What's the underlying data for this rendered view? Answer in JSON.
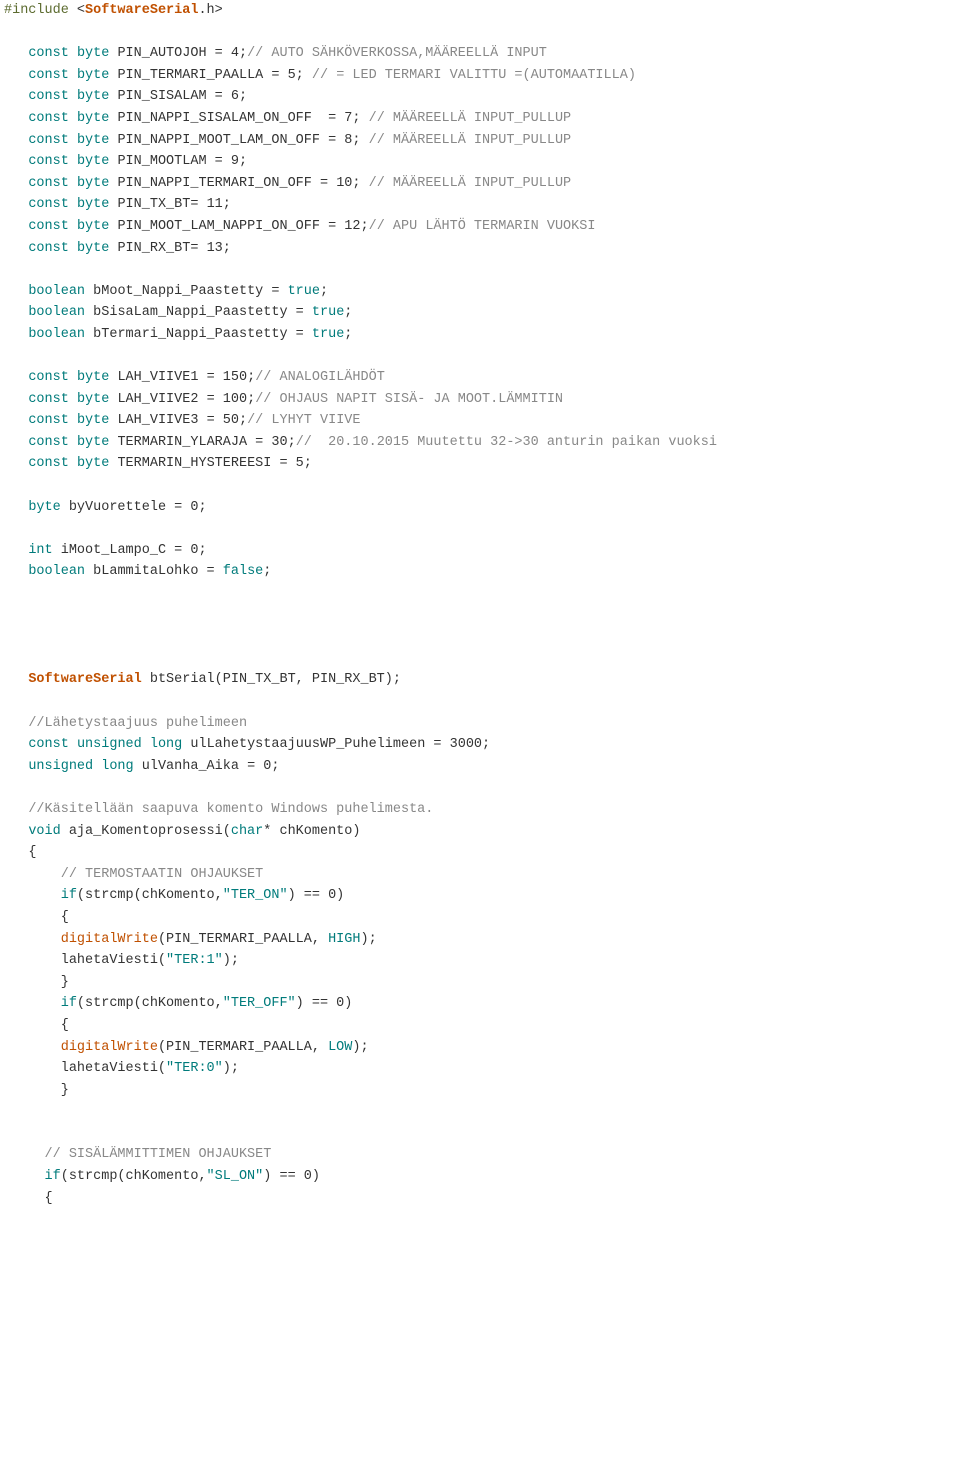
{
  "lines": [
    {
      "t": "include",
      "header": "SoftwareSerial"
    },
    {
      "t": "blank"
    },
    {
      "t": "raw",
      "segs": [
        {
          "c": "sp",
          "v": "   "
        },
        {
          "c": "kw",
          "v": "const"
        },
        {
          "c": "sp",
          "v": " "
        },
        {
          "c": "kw",
          "v": "byte"
        },
        {
          "c": "sp",
          "v": " "
        },
        {
          "c": "plain",
          "v": "PIN_AUTOJOH = 4;"
        },
        {
          "c": "cmt",
          "v": "// AUTO SÄHKÖVERKOSSA,MÄÄREELLÄ INPUT"
        }
      ]
    },
    {
      "t": "raw",
      "segs": [
        {
          "c": "sp",
          "v": "   "
        },
        {
          "c": "kw",
          "v": "const"
        },
        {
          "c": "sp",
          "v": " "
        },
        {
          "c": "kw",
          "v": "byte"
        },
        {
          "c": "sp",
          "v": " "
        },
        {
          "c": "plain",
          "v": "PIN_TERMARI_PAALLA = 5; "
        },
        {
          "c": "cmt",
          "v": "// = LED TERMARI VALITTU =(AUTOMAATILLA)"
        }
      ]
    },
    {
      "t": "raw",
      "segs": [
        {
          "c": "sp",
          "v": "   "
        },
        {
          "c": "kw",
          "v": "const"
        },
        {
          "c": "sp",
          "v": " "
        },
        {
          "c": "kw",
          "v": "byte"
        },
        {
          "c": "sp",
          "v": " "
        },
        {
          "c": "plain",
          "v": "PIN_SISALAM = 6;"
        }
      ]
    },
    {
      "t": "raw",
      "segs": [
        {
          "c": "sp",
          "v": "   "
        },
        {
          "c": "kw",
          "v": "const"
        },
        {
          "c": "sp",
          "v": " "
        },
        {
          "c": "kw",
          "v": "byte"
        },
        {
          "c": "sp",
          "v": " "
        },
        {
          "c": "plain",
          "v": "PIN_NAPPI_SISALAM_ON_OFF  = 7; "
        },
        {
          "c": "cmt",
          "v": "// MÄÄREELLÄ INPUT_PULLUP"
        }
      ]
    },
    {
      "t": "raw",
      "segs": [
        {
          "c": "sp",
          "v": "   "
        },
        {
          "c": "kw",
          "v": "const"
        },
        {
          "c": "sp",
          "v": " "
        },
        {
          "c": "kw",
          "v": "byte"
        },
        {
          "c": "sp",
          "v": " "
        },
        {
          "c": "plain",
          "v": "PIN_NAPPI_MOOT_LAM_ON_OFF = 8; "
        },
        {
          "c": "cmt",
          "v": "// MÄÄREELLÄ INPUT_PULLUP"
        }
      ]
    },
    {
      "t": "raw",
      "segs": [
        {
          "c": "sp",
          "v": "   "
        },
        {
          "c": "kw",
          "v": "const"
        },
        {
          "c": "sp",
          "v": " "
        },
        {
          "c": "kw",
          "v": "byte"
        },
        {
          "c": "sp",
          "v": " "
        },
        {
          "c": "plain",
          "v": "PIN_MOOTLAM = 9;"
        }
      ]
    },
    {
      "t": "raw",
      "segs": [
        {
          "c": "sp",
          "v": "   "
        },
        {
          "c": "kw",
          "v": "const"
        },
        {
          "c": "sp",
          "v": " "
        },
        {
          "c": "kw",
          "v": "byte"
        },
        {
          "c": "sp",
          "v": " "
        },
        {
          "c": "plain",
          "v": "PIN_NAPPI_TERMARI_ON_OFF = 10; "
        },
        {
          "c": "cmt",
          "v": "// MÄÄREELLÄ INPUT_PULLUP"
        }
      ]
    },
    {
      "t": "raw",
      "segs": [
        {
          "c": "sp",
          "v": "   "
        },
        {
          "c": "kw",
          "v": "const"
        },
        {
          "c": "sp",
          "v": " "
        },
        {
          "c": "kw",
          "v": "byte"
        },
        {
          "c": "sp",
          "v": " "
        },
        {
          "c": "plain",
          "v": "PIN_TX_BT= 11;"
        }
      ]
    },
    {
      "t": "raw",
      "segs": [
        {
          "c": "sp",
          "v": "   "
        },
        {
          "c": "kw",
          "v": "const"
        },
        {
          "c": "sp",
          "v": " "
        },
        {
          "c": "kw",
          "v": "byte"
        },
        {
          "c": "sp",
          "v": " "
        },
        {
          "c": "plain",
          "v": "PIN_MOOT_LAM_NAPPI_ON_OFF = 12;"
        },
        {
          "c": "cmt",
          "v": "// APU LÄHTÖ TERMARIN VUOKSI"
        }
      ]
    },
    {
      "t": "raw",
      "segs": [
        {
          "c": "sp",
          "v": "   "
        },
        {
          "c": "kw",
          "v": "const"
        },
        {
          "c": "sp",
          "v": " "
        },
        {
          "c": "kw",
          "v": "byte"
        },
        {
          "c": "sp",
          "v": " "
        },
        {
          "c": "plain",
          "v": "PIN_RX_BT= 13;"
        }
      ]
    },
    {
      "t": "blank"
    },
    {
      "t": "raw",
      "segs": [
        {
          "c": "sp",
          "v": "   "
        },
        {
          "c": "kw",
          "v": "boolean"
        },
        {
          "c": "sp",
          "v": " "
        },
        {
          "c": "plain",
          "v": "bMoot_Nappi_Paastetty = "
        },
        {
          "c": "lit",
          "v": "true"
        },
        {
          "c": "plain",
          "v": ";"
        }
      ]
    },
    {
      "t": "raw",
      "segs": [
        {
          "c": "sp",
          "v": "   "
        },
        {
          "c": "kw",
          "v": "boolean"
        },
        {
          "c": "sp",
          "v": " "
        },
        {
          "c": "plain",
          "v": "bSisaLam_Nappi_Paastetty = "
        },
        {
          "c": "lit",
          "v": "true"
        },
        {
          "c": "plain",
          "v": ";"
        }
      ]
    },
    {
      "t": "raw",
      "segs": [
        {
          "c": "sp",
          "v": "   "
        },
        {
          "c": "kw",
          "v": "boolean"
        },
        {
          "c": "sp",
          "v": " "
        },
        {
          "c": "plain",
          "v": "bTermari_Nappi_Paastetty = "
        },
        {
          "c": "lit",
          "v": "true"
        },
        {
          "c": "plain",
          "v": ";"
        }
      ]
    },
    {
      "t": "blank"
    },
    {
      "t": "raw",
      "segs": [
        {
          "c": "sp",
          "v": "   "
        },
        {
          "c": "kw",
          "v": "const"
        },
        {
          "c": "sp",
          "v": " "
        },
        {
          "c": "kw",
          "v": "byte"
        },
        {
          "c": "sp",
          "v": " "
        },
        {
          "c": "plain",
          "v": "LAH_VIIVE1 = 150;"
        },
        {
          "c": "cmt",
          "v": "// ANALOGILÄHDÖT"
        }
      ]
    },
    {
      "t": "raw",
      "segs": [
        {
          "c": "sp",
          "v": "   "
        },
        {
          "c": "kw",
          "v": "const"
        },
        {
          "c": "sp",
          "v": " "
        },
        {
          "c": "kw",
          "v": "byte"
        },
        {
          "c": "sp",
          "v": " "
        },
        {
          "c": "plain",
          "v": "LAH_VIIVE2 = 100;"
        },
        {
          "c": "cmt",
          "v": "// OHJAUS NAPIT SISÄ- JA MOOT.LÄMMITIN"
        }
      ]
    },
    {
      "t": "raw",
      "segs": [
        {
          "c": "sp",
          "v": "   "
        },
        {
          "c": "kw",
          "v": "const"
        },
        {
          "c": "sp",
          "v": " "
        },
        {
          "c": "kw",
          "v": "byte"
        },
        {
          "c": "sp",
          "v": " "
        },
        {
          "c": "plain",
          "v": "LAH_VIIVE3 = 50;"
        },
        {
          "c": "cmt",
          "v": "// LYHYT VIIVE"
        }
      ]
    },
    {
      "t": "raw",
      "segs": [
        {
          "c": "sp",
          "v": "   "
        },
        {
          "c": "kw",
          "v": "const"
        },
        {
          "c": "sp",
          "v": " "
        },
        {
          "c": "kw",
          "v": "byte"
        },
        {
          "c": "sp",
          "v": " "
        },
        {
          "c": "plain",
          "v": "TERMARIN_YLARAJA = 30;"
        },
        {
          "c": "cmt",
          "v": "//  20.10.2015 Muutettu 32->30 anturin paikan vuoksi"
        }
      ]
    },
    {
      "t": "raw",
      "segs": [
        {
          "c": "sp",
          "v": "   "
        },
        {
          "c": "kw",
          "v": "const"
        },
        {
          "c": "sp",
          "v": " "
        },
        {
          "c": "kw",
          "v": "byte"
        },
        {
          "c": "sp",
          "v": " "
        },
        {
          "c": "plain",
          "v": "TERMARIN_HYSTEREESI = 5;"
        }
      ]
    },
    {
      "t": "blank"
    },
    {
      "t": "raw",
      "segs": [
        {
          "c": "sp",
          "v": "   "
        },
        {
          "c": "kw",
          "v": "byte"
        },
        {
          "c": "sp",
          "v": " "
        },
        {
          "c": "plain",
          "v": "byVuorettele = 0;"
        }
      ]
    },
    {
      "t": "blank"
    },
    {
      "t": "raw",
      "segs": [
        {
          "c": "sp",
          "v": "   "
        },
        {
          "c": "kw",
          "v": "int"
        },
        {
          "c": "sp",
          "v": " "
        },
        {
          "c": "plain",
          "v": "iMoot_Lampo_C = 0;"
        }
      ]
    },
    {
      "t": "raw",
      "segs": [
        {
          "c": "sp",
          "v": "   "
        },
        {
          "c": "kw",
          "v": "boolean"
        },
        {
          "c": "sp",
          "v": " "
        },
        {
          "c": "plain",
          "v": "bLammitaLohko = "
        },
        {
          "c": "lit",
          "v": "false"
        },
        {
          "c": "plain",
          "v": ";"
        }
      ]
    },
    {
      "t": "blank"
    },
    {
      "t": "blank"
    },
    {
      "t": "blank"
    },
    {
      "t": "blank"
    },
    {
      "t": "raw",
      "segs": [
        {
          "c": "sp",
          "v": "   "
        },
        {
          "c": "type",
          "v": "SoftwareSerial"
        },
        {
          "c": "sp",
          "v": " "
        },
        {
          "c": "plain",
          "v": "btSerial(PIN_TX_BT, PIN_RX_BT);"
        }
      ]
    },
    {
      "t": "blank"
    },
    {
      "t": "raw",
      "segs": [
        {
          "c": "sp",
          "v": "   "
        },
        {
          "c": "cmt",
          "v": "//Lähetystaajuus puhelimeen"
        }
      ]
    },
    {
      "t": "raw",
      "segs": [
        {
          "c": "sp",
          "v": "   "
        },
        {
          "c": "kw",
          "v": "const"
        },
        {
          "c": "sp",
          "v": " "
        },
        {
          "c": "kw",
          "v": "unsigned"
        },
        {
          "c": "sp",
          "v": " "
        },
        {
          "c": "kw",
          "v": "long"
        },
        {
          "c": "sp",
          "v": " "
        },
        {
          "c": "plain",
          "v": "ulLahetystaajuusWP_Puhelimeen = 3000;"
        }
      ]
    },
    {
      "t": "raw",
      "segs": [
        {
          "c": "sp",
          "v": "   "
        },
        {
          "c": "kw",
          "v": "unsigned"
        },
        {
          "c": "sp",
          "v": " "
        },
        {
          "c": "kw",
          "v": "long"
        },
        {
          "c": "sp",
          "v": " "
        },
        {
          "c": "plain",
          "v": "ulVanha_Aika = 0;"
        }
      ]
    },
    {
      "t": "blank"
    },
    {
      "t": "raw",
      "segs": [
        {
          "c": "sp",
          "v": "   "
        },
        {
          "c": "cmt",
          "v": "//Käsitellään saapuva komento Windows puhelimesta."
        }
      ]
    },
    {
      "t": "raw",
      "segs": [
        {
          "c": "sp",
          "v": "   "
        },
        {
          "c": "kw",
          "v": "void"
        },
        {
          "c": "sp",
          "v": " "
        },
        {
          "c": "plain",
          "v": "aja_Komentoprosessi("
        },
        {
          "c": "kw",
          "v": "char"
        },
        {
          "c": "plain",
          "v": "* chKomento)"
        }
      ]
    },
    {
      "t": "raw",
      "segs": [
        {
          "c": "sp",
          "v": "   "
        },
        {
          "c": "plain",
          "v": "{"
        }
      ]
    },
    {
      "t": "raw",
      "segs": [
        {
          "c": "sp",
          "v": "       "
        },
        {
          "c": "cmt",
          "v": "// TERMOSTAATIN OHJAUKSET"
        }
      ]
    },
    {
      "t": "raw",
      "segs": [
        {
          "c": "sp",
          "v": "       "
        },
        {
          "c": "kw",
          "v": "if"
        },
        {
          "c": "plain",
          "v": "(strcmp(chKomento,"
        },
        {
          "c": "str",
          "v": "\"TER_ON\""
        },
        {
          "c": "plain",
          "v": ") == 0)"
        }
      ]
    },
    {
      "t": "raw",
      "segs": [
        {
          "c": "sp",
          "v": "       "
        },
        {
          "c": "plain",
          "v": "{"
        }
      ]
    },
    {
      "t": "raw",
      "segs": [
        {
          "c": "sp",
          "v": "       "
        },
        {
          "c": "fn",
          "v": "digitalWrite"
        },
        {
          "c": "plain",
          "v": "(PIN_TERMARI_PAALLA, "
        },
        {
          "c": "lit",
          "v": "HIGH"
        },
        {
          "c": "plain",
          "v": ");"
        }
      ]
    },
    {
      "t": "raw",
      "segs": [
        {
          "c": "sp",
          "v": "       "
        },
        {
          "c": "plain",
          "v": "lahetaViesti("
        },
        {
          "c": "str",
          "v": "\"TER:1\""
        },
        {
          "c": "plain",
          "v": ");"
        }
      ]
    },
    {
      "t": "raw",
      "segs": [
        {
          "c": "sp",
          "v": "       "
        },
        {
          "c": "plain",
          "v": "}"
        }
      ]
    },
    {
      "t": "raw",
      "segs": [
        {
          "c": "sp",
          "v": "       "
        },
        {
          "c": "kw",
          "v": "if"
        },
        {
          "c": "plain",
          "v": "(strcmp(chKomento,"
        },
        {
          "c": "str",
          "v": "\"TER_OFF\""
        },
        {
          "c": "plain",
          "v": ") == 0)"
        }
      ]
    },
    {
      "t": "raw",
      "segs": [
        {
          "c": "sp",
          "v": "       "
        },
        {
          "c": "plain",
          "v": "{"
        }
      ]
    },
    {
      "t": "raw",
      "segs": [
        {
          "c": "sp",
          "v": "       "
        },
        {
          "c": "fn",
          "v": "digitalWrite"
        },
        {
          "c": "plain",
          "v": "(PIN_TERMARI_PAALLA, "
        },
        {
          "c": "lit",
          "v": "LOW"
        },
        {
          "c": "plain",
          "v": ");"
        }
      ]
    },
    {
      "t": "raw",
      "segs": [
        {
          "c": "sp",
          "v": "       "
        },
        {
          "c": "plain",
          "v": "lahetaViesti("
        },
        {
          "c": "str",
          "v": "\"TER:0\""
        },
        {
          "c": "plain",
          "v": ");"
        }
      ]
    },
    {
      "t": "raw",
      "segs": [
        {
          "c": "sp",
          "v": "       "
        },
        {
          "c": "plain",
          "v": "}"
        }
      ]
    },
    {
      "t": "blank"
    },
    {
      "t": "blank"
    },
    {
      "t": "raw",
      "segs": [
        {
          "c": "sp",
          "v": "     "
        },
        {
          "c": "cmt",
          "v": "// SISÄLÄMMITTIMEN OHJAUKSET"
        }
      ]
    },
    {
      "t": "raw",
      "segs": [
        {
          "c": "sp",
          "v": "     "
        },
        {
          "c": "kw",
          "v": "if"
        },
        {
          "c": "plain",
          "v": "(strcmp(chKomento,"
        },
        {
          "c": "str",
          "v": "\"SL_ON\""
        },
        {
          "c": "plain",
          "v": ") == 0)"
        }
      ]
    },
    {
      "t": "raw",
      "segs": [
        {
          "c": "sp",
          "v": "     "
        },
        {
          "c": "plain",
          "v": "{"
        }
      ]
    }
  ]
}
